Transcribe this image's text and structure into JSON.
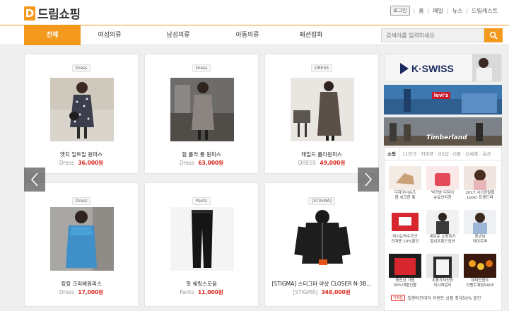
{
  "header": {
    "logo_letter": "D",
    "logo_text": "드림쇼핑",
    "login_label": "로그인",
    "links": [
      "홈",
      "메일",
      "뉴스",
      "드림캐스트"
    ]
  },
  "nav": {
    "tabs": [
      "전체",
      "여성의류",
      "남성의류",
      "아동의류",
      "패션잡화"
    ],
    "active_index": 0,
    "search_placeholder": "검색어를 입력하세요"
  },
  "products": [
    {
      "tag": "Dress",
      "name": "엣지 얼트릴 원피스",
      "brand": "Dress",
      "price": "36,000원"
    },
    {
      "tag": "Dress",
      "name": "힘 롤라 롱 원피스",
      "brand": "Dress",
      "price": "63,000원"
    },
    {
      "tag": "DRESS",
      "name": "테일드 롤라원피스",
      "brand": "DRESS",
      "price": "49,000원"
    },
    {
      "tag": "Dress",
      "name": "킹킹 크리베원피스",
      "brand": "Dress",
      "price": "17,000원"
    },
    {
      "tag": "Pants",
      "name": "핫 쉐링스모음",
      "brand": "Pants",
      "price": "11,000원"
    },
    {
      "tag": "[STIGMA]",
      "name": "[STIGMA] 스티그마 야상 CLOSER N-3B…",
      "brand": "[STIGMA]",
      "price": "348,000원"
    }
  ],
  "banners": {
    "kswiss": "K·SWISS",
    "levis": "levi's",
    "timberland": "Timberland"
  },
  "shop": {
    "active_tab": "쇼핑",
    "other_tabs": "11번가 · 지마켓 · GS샵 · G몰 · 신세계 · 옥션",
    "items": [
      {
        "caption": "디자이너슈즈\n봄 쉬크한 룩"
      },
      {
        "caption": "빅가방 디자이\n슈요인티한"
      },
      {
        "caption": "2017 시선강탈할\nLook! 트렌드퍼"
      },
      {
        "caption": "미시는박수모굿\n전개용 10%할인"
      },
      {
        "caption": "새로운 쇼핑특가\n열선프렌드업어"
      },
      {
        "caption": "중년님\n데이트퍼"
      },
      {
        "caption": "봄신상 가볍\n30%대할인몰"
      },
      {
        "caption": "초봄가치신랑\n미시데일리"
      },
      {
        "caption": "데파인원도\n이벤트웨임SALE"
      }
    ],
    "bottom_badge": "기획전",
    "bottom_text": "발렌타인데이 이벤트 상품 최대50% 할인"
  },
  "colors": {
    "accent": "#f39a1e",
    "price": "#d9281f"
  }
}
